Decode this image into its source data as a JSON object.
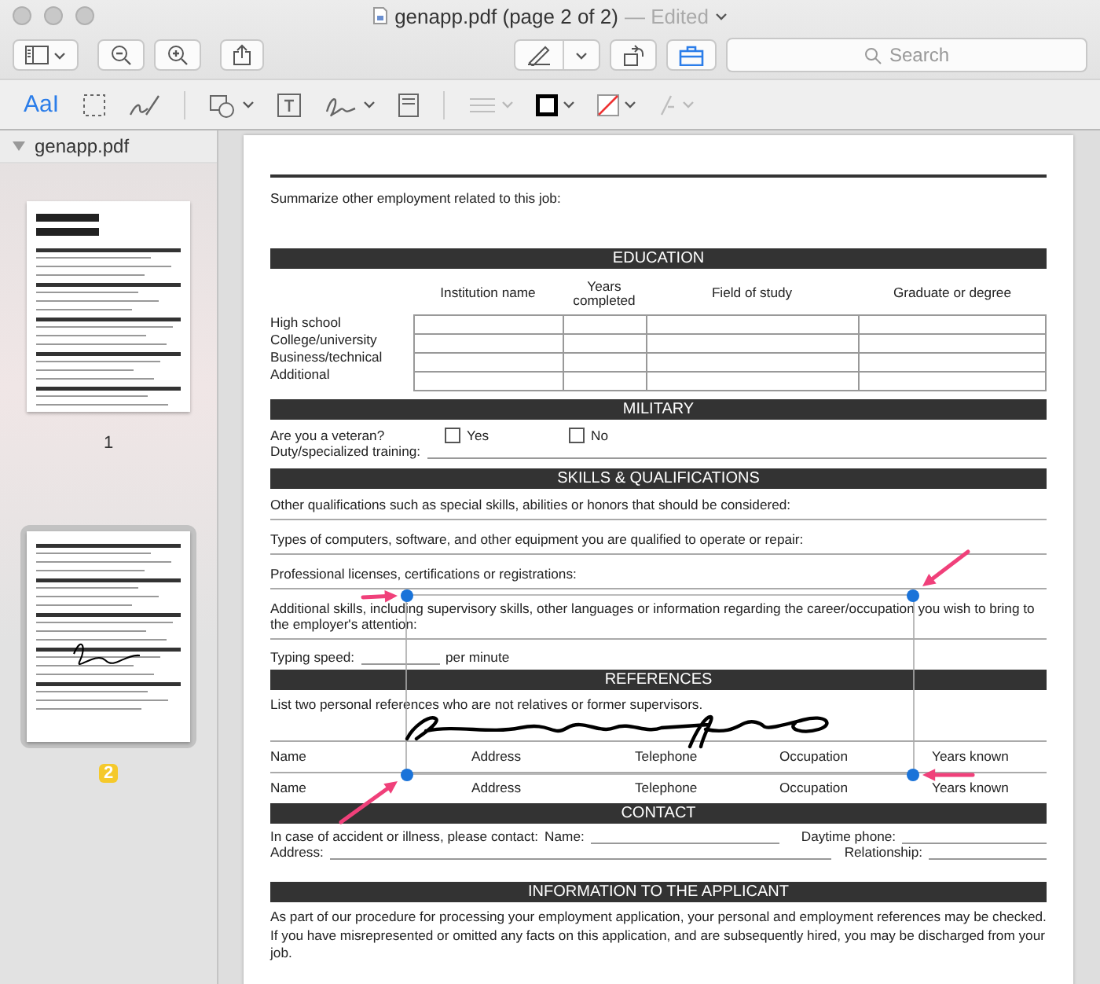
{
  "window": {
    "title": "genapp.pdf (page 2 of 2)",
    "status": "— Edited"
  },
  "toolbar": {
    "search": {
      "placeholder": "Search"
    }
  },
  "markup_tools": [
    {
      "kind": "text",
      "label": "AaI",
      "selected": true,
      "disabled": false
    },
    {
      "kind": "rect",
      "selected": false,
      "disabled": false
    },
    {
      "kind": "sketch",
      "selected": false,
      "disabled": false
    },
    {
      "kind": "shapes",
      "selected": false,
      "disabled": false
    },
    {
      "kind": "textbox",
      "selected": false,
      "disabled": false
    },
    {
      "kind": "sign",
      "selected": false,
      "disabled": false
    },
    {
      "kind": "note",
      "selected": false,
      "disabled": false
    },
    {
      "kind": "linestyle",
      "selected": false,
      "disabled": true
    },
    {
      "kind": "border",
      "selected": false,
      "disabled": false
    },
    {
      "kind": "fill",
      "selected": false,
      "disabled": false
    },
    {
      "kind": "font",
      "selected": false,
      "disabled": true
    }
  ],
  "sidebar": {
    "file": "genapp.pdf",
    "pages": [
      {
        "label": "1",
        "selected": false
      },
      {
        "label": "2",
        "selected": true
      }
    ]
  },
  "document": {
    "intro": "Summarize other employment related to this job:",
    "education": {
      "heading": "EDUCATION",
      "columns": [
        "Institution name",
        "Years completed",
        "Field of study",
        "Graduate or degree"
      ],
      "rows": [
        "High school",
        "College/university",
        "Business/technical",
        "Additional"
      ]
    },
    "military": {
      "heading": "MILITARY",
      "question": "Are you a veteran?",
      "options": [
        {
          "label": "Yes",
          "checked": false
        },
        {
          "label": "No",
          "checked": false
        }
      ],
      "training": "Duty/specialized training:"
    },
    "skills": {
      "heading": "SKILLS & QUALIFICATIONS",
      "prompts": [
        "Other qualifications such as special skills, abilities or honors that should be considered:",
        "Types of computers, software, and other equipment you are qualified to operate or repair:",
        "Professional licenses, certifications or registrations:",
        "Additional skills, including supervisory skills, other languages or information regarding the career/occupation you wish to bring to the employer's attention:"
      ],
      "typing_label": "Typing speed:",
      "typing_unit": "per minute"
    },
    "references": {
      "heading": "REFERENCES",
      "intro": "List two personal references who are not relatives or former supervisors.",
      "rows": [
        [
          "Name",
          "Address",
          "Telephone",
          "Occupation",
          "Years known"
        ],
        [
          "Name",
          "Address",
          "Telephone",
          "Occupation",
          "Years known"
        ]
      ]
    },
    "contact": {
      "heading": "CONTACT",
      "prompt": "In case of accident or illness, please contact:",
      "name": "Name:",
      "phone": "Daytime phone:",
      "address": "Address:",
      "relationship": "Relationship:"
    },
    "info": {
      "heading": "INFORMATION TO THE APPLICANT",
      "text": "As part of our procedure for processing your employment application, your personal and employment references may be checked. If you have misrepresented or omitted any facts on this application, and are subsequently hired, you may be discharged from your job."
    }
  }
}
